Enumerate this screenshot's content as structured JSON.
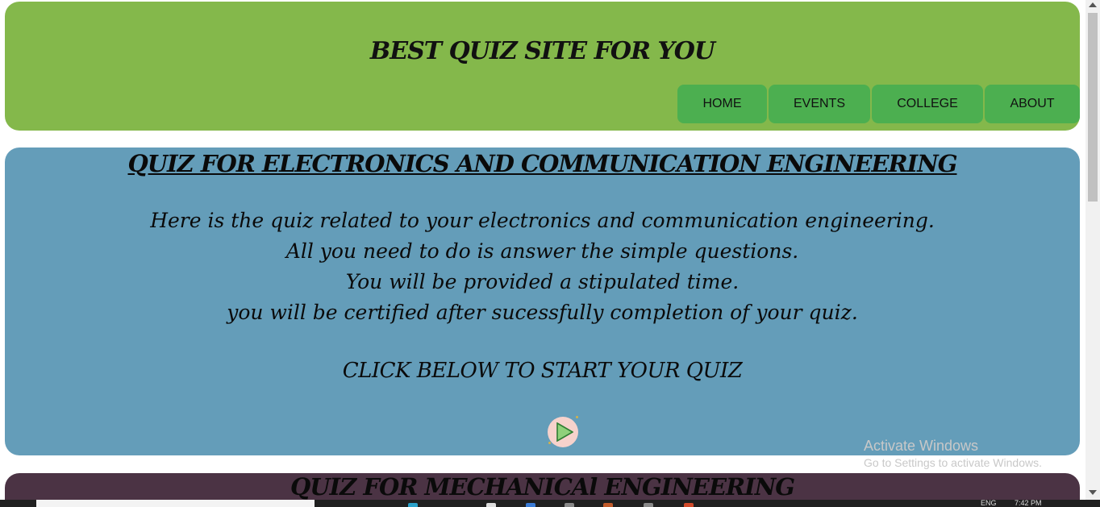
{
  "header": {
    "title": "BEST QUIZ SITE FOR YOU",
    "nav": [
      {
        "label": "HOME"
      },
      {
        "label": "EVENTS"
      },
      {
        "label": "COLLEGE"
      },
      {
        "label": "ABOUT"
      }
    ]
  },
  "ece_card": {
    "title": "QUIZ FOR ELECTRONICS AND COMMUNICATION ENGINEERING",
    "lines": [
      "Here is the quiz related to your electronics and communication engineering.",
      "All you need to do is answer the simple questions.",
      "You will be provided a stipulated time.",
      "you will be certified after sucessfully completion of your quiz."
    ],
    "cta": "CLICK BELOW TO START YOUR QUIZ",
    "play_icon": "play-icon"
  },
  "mech_card": {
    "title": "QUIZ FOR MECHANICAl ENGINEERING"
  },
  "watermark": {
    "title": "Activate Windows",
    "subtitle": "Go to Settings to activate Windows."
  },
  "taskbar": {
    "lang": "ENG",
    "time": "7:42 PM"
  },
  "colors": {
    "header_bg": "#84b84b",
    "nav_bg": "#4caf50",
    "ece_bg": "#649db9",
    "mech_bg": "#4b3344"
  }
}
